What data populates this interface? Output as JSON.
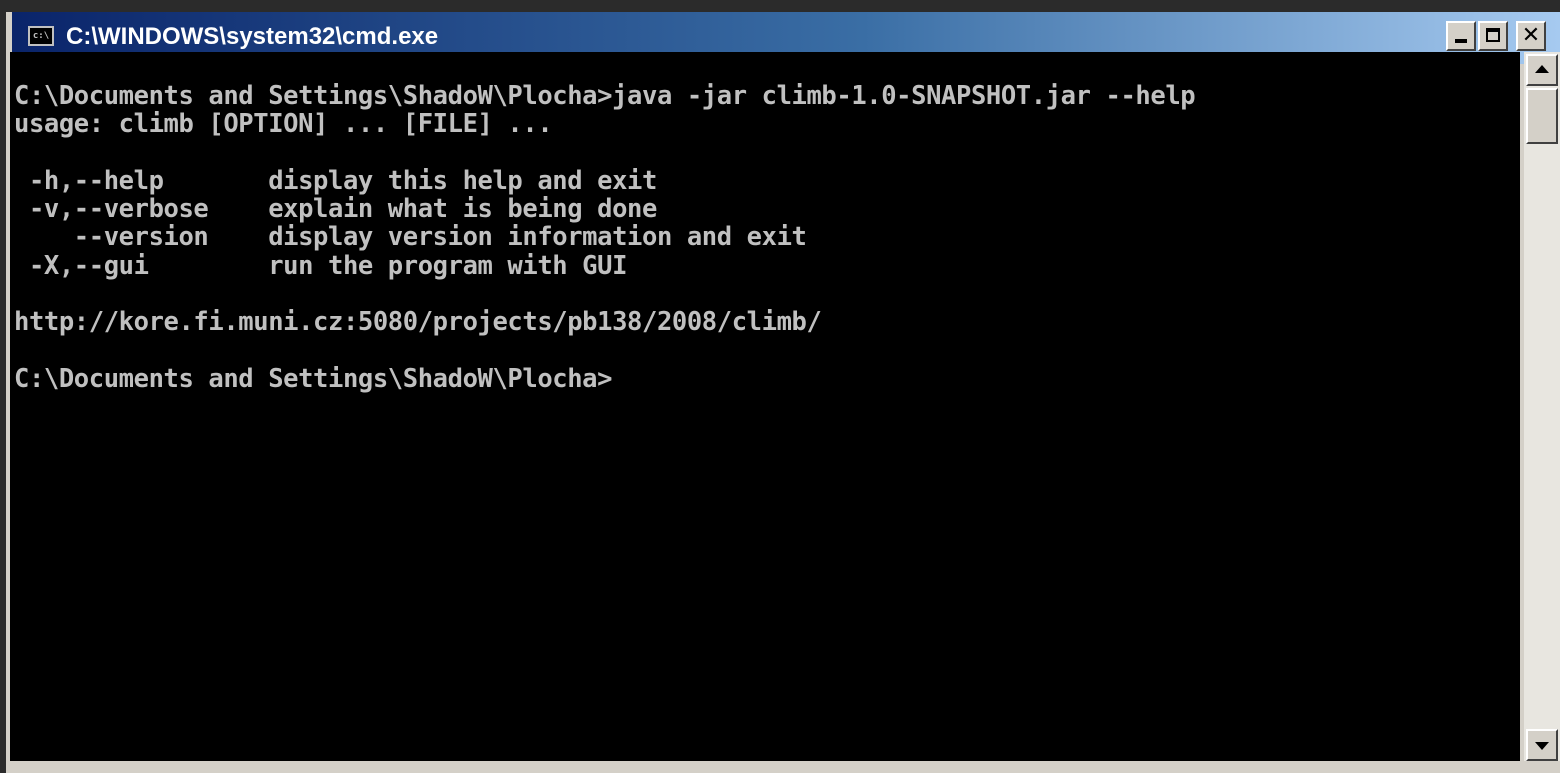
{
  "window": {
    "title": "C:\\WINDOWS\\system32\\cmd.exe",
    "icon": "console-icon",
    "icon_text": "c:\\"
  },
  "titlebar_buttons": {
    "minimize": "minimize-icon",
    "maximize": "maximize-icon",
    "close": "close-icon",
    "close_glyph": "✕"
  },
  "console": {
    "lines": [
      "C:\\Documents and Settings\\ShadoW\\Plocha>java -jar climb-1.0-SNAPSHOT.jar --help",
      "usage: climb [OPTION] ... [FILE] ...",
      "",
      " -h,--help       display this help and exit",
      " -v,--verbose    explain what is being done",
      "    --version    display version information and exit",
      " -X,--gui        run the program with GUI",
      "",
      "http://kore.fi.muni.cz:5080/projects/pb138/2008/climb/",
      "",
      "C:\\Documents and Settings\\ShadoW\\Plocha>"
    ]
  },
  "colors": {
    "console_background": "#000000",
    "console_text": "#c0c0c0",
    "titlebar_start": "#0a246a",
    "titlebar_end": "#a6caf0"
  }
}
